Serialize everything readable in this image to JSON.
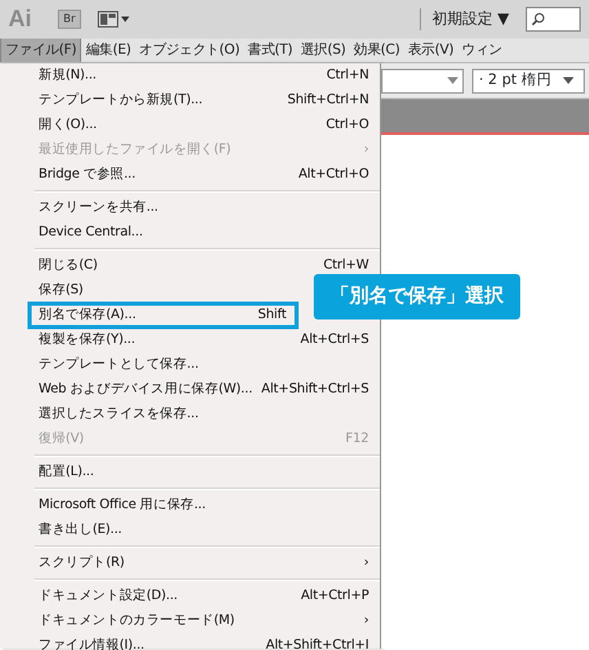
{
  "app_bar": {
    "logo": "Ai",
    "bridge_button": "Br",
    "workspace": "初期設定 ▼"
  },
  "menu_bar": [
    {
      "label": "ファイル(F)",
      "selected": true
    },
    {
      "label": "編集(E)",
      "selected": false
    },
    {
      "label": "オブジェクト(O)",
      "selected": false
    },
    {
      "label": "書式(T)",
      "selected": false
    },
    {
      "label": "選択(S)",
      "selected": false
    },
    {
      "label": "効果(C)",
      "selected": false
    },
    {
      "label": "表示(V)",
      "selected": false
    },
    {
      "label": "ウィン",
      "selected": false
    }
  ],
  "control_bar": {
    "brush": "· 2 pt 楕円"
  },
  "file_menu": [
    {
      "kind": "item",
      "label": "新規(N)...",
      "shortcut": "Ctrl+N",
      "disabled": false,
      "outlined": false
    },
    {
      "kind": "item",
      "label": "テンプレートから新規(T)...",
      "shortcut": "Shift+Ctrl+N",
      "disabled": false,
      "outlined": false
    },
    {
      "kind": "item",
      "label": "開く(O)...",
      "shortcut": "Ctrl+O",
      "disabled": false,
      "outlined": false
    },
    {
      "kind": "submenu",
      "label": "最近使用したファイルを開く(F)",
      "arrow": "›",
      "disabled": true,
      "outlined": false
    },
    {
      "kind": "item",
      "label": "Bridge で参照...",
      "shortcut": "Alt+Ctrl+O",
      "disabled": false,
      "outlined": false
    },
    {
      "kind": "separator"
    },
    {
      "kind": "item",
      "label": "スクリーンを共有...",
      "disabled": false,
      "outlined": false
    },
    {
      "kind": "item",
      "label": "Device Central...",
      "disabled": false,
      "outlined": false
    },
    {
      "kind": "separator"
    },
    {
      "kind": "item",
      "label": "閉じる(C)",
      "shortcut": "Ctrl+W",
      "disabled": false,
      "outlined": false
    },
    {
      "kind": "item",
      "label": "保存(S)",
      "disabled": false,
      "outlined": false
    },
    {
      "kind": "item",
      "label": "別名で保存(A)...",
      "shortcut": "Shift",
      "disabled": false,
      "outlined": true
    },
    {
      "kind": "item",
      "label": "複製を保存(Y)...",
      "shortcut": "Alt+Ctrl+S",
      "disabled": false,
      "outlined": false
    },
    {
      "kind": "item",
      "label": "テンプレートとして保存...",
      "disabled": false,
      "outlined": false
    },
    {
      "kind": "item",
      "label": "Web およびデバイス用に保存(W)...",
      "shortcut": "Alt+Shift+Ctrl+S",
      "disabled": false,
      "outlined": false
    },
    {
      "kind": "item",
      "label": "選択したスライスを保存...",
      "disabled": false,
      "outlined": false
    },
    {
      "kind": "item",
      "label": "復帰(V)",
      "shortcut": "F12",
      "disabled": true,
      "outlined": false
    },
    {
      "kind": "separator"
    },
    {
      "kind": "item",
      "label": "配置(L)...",
      "disabled": false,
      "outlined": false
    },
    {
      "kind": "separator"
    },
    {
      "kind": "item",
      "label": "Microsoft Office 用に保存...",
      "disabled": false,
      "outlined": false
    },
    {
      "kind": "item",
      "label": "書き出し(E)...",
      "disabled": false,
      "outlined": false
    },
    {
      "kind": "separator"
    },
    {
      "kind": "submenu",
      "label": "スクリプト(R)",
      "arrow": "›",
      "disabled": false,
      "outlined": false
    },
    {
      "kind": "separator"
    },
    {
      "kind": "item",
      "label": "ドキュメント設定(D)...",
      "shortcut": "Alt+Ctrl+P",
      "disabled": false,
      "outlined": false
    },
    {
      "kind": "submenu",
      "label": "ドキュメントのカラーモード(M)",
      "arrow": "›",
      "disabled": false,
      "outlined": false
    },
    {
      "kind": "item",
      "label": "ファイル情報(I)...",
      "shortcut": "Alt+Shift+Ctrl+I",
      "disabled": false,
      "outlined": false
    }
  ],
  "callout": {
    "text": "「別名で保存」選択"
  }
}
